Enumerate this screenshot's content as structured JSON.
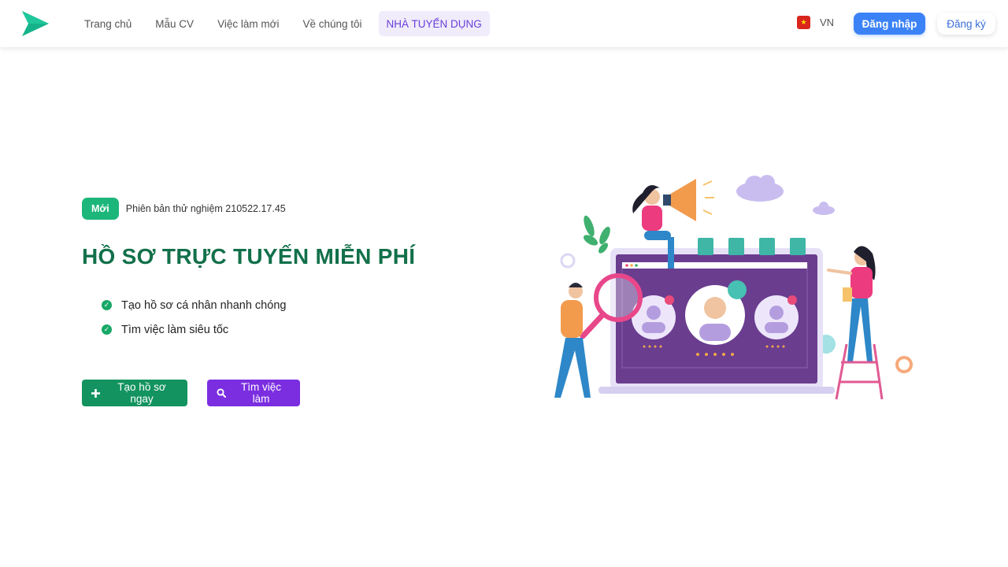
{
  "header": {
    "logo_icon": "play-arrow-logo",
    "nav": [
      {
        "label": "Trang chủ"
      },
      {
        "label": "Mẫu CV"
      },
      {
        "label": "Việc làm mới"
      },
      {
        "label": "Về chúng tôi"
      },
      {
        "label": "NHÀ TUYỂN DỤNG"
      }
    ],
    "language": {
      "label": "VN",
      "flag_icon": "vietnam-flag-icon"
    },
    "login_label": "Đăng nhập",
    "register_label": "Đăng ký"
  },
  "hero": {
    "badge": "Mới",
    "version": "Phiên bản thử nghiệm 210522.17.45",
    "title": "HỒ SƠ TRỰC TUYẾN MIỄN PHÍ",
    "features": [
      {
        "text": "Tạo hồ sơ cá nhân nhanh chóng",
        "icon": "check-circle-icon"
      },
      {
        "text": "Tìm việc làm siêu tốc",
        "icon": "check-circle-icon"
      }
    ],
    "cta_primary": {
      "label": "Tạo hồ sơ ngay",
      "icon": "plus-icon"
    },
    "cta_secondary": {
      "label": "Tìm việc làm",
      "icon": "search-icon"
    }
  },
  "colors": {
    "brand_green": "#12704a",
    "badge_green": "#1cb67a",
    "cta_green": "#13935f",
    "cta_purple": "#7a2ee0",
    "login_blue": "#3b82f6",
    "employer_bg": "#f0ecfb"
  }
}
